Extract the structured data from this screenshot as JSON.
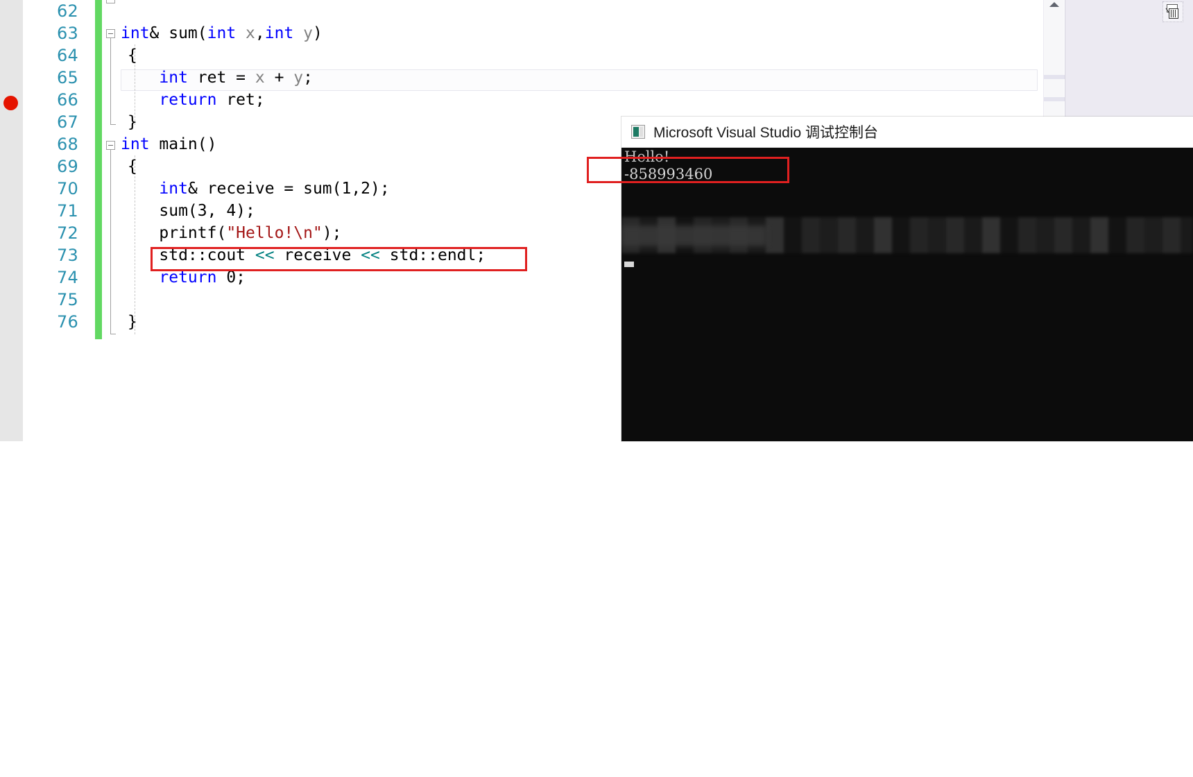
{
  "editor": {
    "line_numbers": [
      "62",
      "63",
      "64",
      "65",
      "66",
      "67",
      "68",
      "69",
      "70",
      "71",
      "72",
      "73",
      "74",
      "75",
      "76"
    ],
    "lines": [
      {
        "n": "62",
        "segments": []
      },
      {
        "n": "63",
        "segments": [
          {
            "t": "int",
            "c": "kw"
          },
          {
            "t": "& sum(",
            "c": "ident"
          },
          {
            "t": "int",
            "c": "kw"
          },
          {
            "t": " x",
            "c": "param"
          },
          {
            "t": ",",
            "c": "ident"
          },
          {
            "t": "int",
            "c": "kw"
          },
          {
            "t": " y",
            "c": "param"
          },
          {
            "t": ")",
            "c": "ident"
          }
        ]
      },
      {
        "n": "64",
        "segments": [
          {
            "t": "{",
            "c": "ident"
          }
        ]
      },
      {
        "n": "65",
        "segments": [
          {
            "t": "    ",
            "c": "ident"
          },
          {
            "t": "int",
            "c": "kw"
          },
          {
            "t": " ret = ",
            "c": "ident"
          },
          {
            "t": "x",
            "c": "param"
          },
          {
            "t": " + ",
            "c": "ident"
          },
          {
            "t": "y",
            "c": "param"
          },
          {
            "t": ";",
            "c": "ident"
          }
        ]
      },
      {
        "n": "66",
        "segments": [
          {
            "t": "    ",
            "c": "ident"
          },
          {
            "t": "return",
            "c": "kw"
          },
          {
            "t": " ret;",
            "c": "ident"
          }
        ]
      },
      {
        "n": "67",
        "segments": [
          {
            "t": "}",
            "c": "ident"
          }
        ]
      },
      {
        "n": "68",
        "segments": [
          {
            "t": "int",
            "c": "kw"
          },
          {
            "t": " main()",
            "c": "ident"
          }
        ]
      },
      {
        "n": "69",
        "segments": [
          {
            "t": "{",
            "c": "ident"
          }
        ]
      },
      {
        "n": "70",
        "segments": [
          {
            "t": "    ",
            "c": "ident"
          },
          {
            "t": "int",
            "c": "kw"
          },
          {
            "t": "& receive = sum(1,2);",
            "c": "ident"
          }
        ]
      },
      {
        "n": "71",
        "segments": [
          {
            "t": "    sum(3, 4);",
            "c": "ident"
          }
        ]
      },
      {
        "n": "72",
        "segments": [
          {
            "t": "    printf(",
            "c": "ident"
          },
          {
            "t": "\"Hello!\\n\"",
            "c": "str"
          },
          {
            "t": ");",
            "c": "ident"
          }
        ]
      },
      {
        "n": "73",
        "segments": [
          {
            "t": "    std::cout ",
            "c": "ident"
          },
          {
            "t": "<<",
            "c": "op"
          },
          {
            "t": " receive ",
            "c": "ident"
          },
          {
            "t": "<<",
            "c": "op"
          },
          {
            "t": " std::endl;",
            "c": "ident"
          }
        ]
      },
      {
        "n": "74",
        "segments": [
          {
            "t": "    ",
            "c": "ident"
          },
          {
            "t": "return",
            "c": "kw"
          },
          {
            "t": " 0;",
            "c": "ident"
          }
        ]
      },
      {
        "n": "75",
        "segments": []
      },
      {
        "n": "76",
        "segments": [
          {
            "t": "}",
            "c": "ident"
          }
        ]
      }
    ],
    "code_text": {
      "l62": "",
      "l63": "int& sum(int x,int y)",
      "l64": "{",
      "l65": "    int ret = x + y;",
      "l66": "    return ret;",
      "l67": "}",
      "l68": "int main()",
      "l69": "{",
      "l70": "    int& receive = sum(1,2);",
      "l71": "    sum(3, 4);",
      "l72": "    printf(\"Hello!\\n\");",
      "l73": "    std::cout << receive << std::endl;",
      "l74": "    return 0;",
      "l75": "",
      "l76": "}"
    },
    "breakpoint_line": "66",
    "current_line": "65",
    "colors": {
      "keyword": "#0000ff",
      "string": "#a31515",
      "operator": "#008080",
      "line_number": "#2b91af",
      "change_bar": "#62d862",
      "breakpoint": "#e51400",
      "annotation": "#e02020"
    }
  },
  "console": {
    "title": "Microsoft Visual Studio 调试控制台",
    "output": {
      "line1": "Hello!",
      "line2": "-858993460"
    }
  },
  "annotations": {
    "code_highlight_target": "std::cout << receive << std::endl;",
    "console_highlight_target": "-858993460"
  }
}
